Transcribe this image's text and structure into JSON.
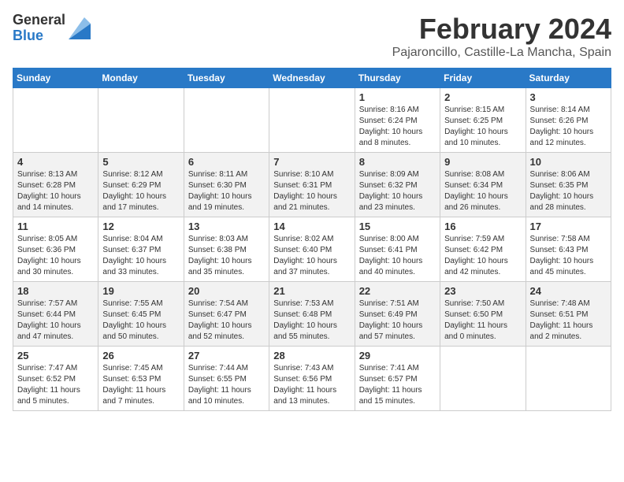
{
  "header": {
    "logo_general": "General",
    "logo_blue": "Blue",
    "month_title": "February 2024",
    "location": "Pajaroncillo, Castille-La Mancha, Spain"
  },
  "days_of_week": [
    "Sunday",
    "Monday",
    "Tuesday",
    "Wednesday",
    "Thursday",
    "Friday",
    "Saturday"
  ],
  "weeks": [
    [
      {
        "day": "",
        "info": ""
      },
      {
        "day": "",
        "info": ""
      },
      {
        "day": "",
        "info": ""
      },
      {
        "day": "",
        "info": ""
      },
      {
        "day": "1",
        "info": "Sunrise: 8:16 AM\nSunset: 6:24 PM\nDaylight: 10 hours\nand 8 minutes."
      },
      {
        "day": "2",
        "info": "Sunrise: 8:15 AM\nSunset: 6:25 PM\nDaylight: 10 hours\nand 10 minutes."
      },
      {
        "day": "3",
        "info": "Sunrise: 8:14 AM\nSunset: 6:26 PM\nDaylight: 10 hours\nand 12 minutes."
      }
    ],
    [
      {
        "day": "4",
        "info": "Sunrise: 8:13 AM\nSunset: 6:28 PM\nDaylight: 10 hours\nand 14 minutes."
      },
      {
        "day": "5",
        "info": "Sunrise: 8:12 AM\nSunset: 6:29 PM\nDaylight: 10 hours\nand 17 minutes."
      },
      {
        "day": "6",
        "info": "Sunrise: 8:11 AM\nSunset: 6:30 PM\nDaylight: 10 hours\nand 19 minutes."
      },
      {
        "day": "7",
        "info": "Sunrise: 8:10 AM\nSunset: 6:31 PM\nDaylight: 10 hours\nand 21 minutes."
      },
      {
        "day": "8",
        "info": "Sunrise: 8:09 AM\nSunset: 6:32 PM\nDaylight: 10 hours\nand 23 minutes."
      },
      {
        "day": "9",
        "info": "Sunrise: 8:08 AM\nSunset: 6:34 PM\nDaylight: 10 hours\nand 26 minutes."
      },
      {
        "day": "10",
        "info": "Sunrise: 8:06 AM\nSunset: 6:35 PM\nDaylight: 10 hours\nand 28 minutes."
      }
    ],
    [
      {
        "day": "11",
        "info": "Sunrise: 8:05 AM\nSunset: 6:36 PM\nDaylight: 10 hours\nand 30 minutes."
      },
      {
        "day": "12",
        "info": "Sunrise: 8:04 AM\nSunset: 6:37 PM\nDaylight: 10 hours\nand 33 minutes."
      },
      {
        "day": "13",
        "info": "Sunrise: 8:03 AM\nSunset: 6:38 PM\nDaylight: 10 hours\nand 35 minutes."
      },
      {
        "day": "14",
        "info": "Sunrise: 8:02 AM\nSunset: 6:40 PM\nDaylight: 10 hours\nand 37 minutes."
      },
      {
        "day": "15",
        "info": "Sunrise: 8:00 AM\nSunset: 6:41 PM\nDaylight: 10 hours\nand 40 minutes."
      },
      {
        "day": "16",
        "info": "Sunrise: 7:59 AM\nSunset: 6:42 PM\nDaylight: 10 hours\nand 42 minutes."
      },
      {
        "day": "17",
        "info": "Sunrise: 7:58 AM\nSunset: 6:43 PM\nDaylight: 10 hours\nand 45 minutes."
      }
    ],
    [
      {
        "day": "18",
        "info": "Sunrise: 7:57 AM\nSunset: 6:44 PM\nDaylight: 10 hours\nand 47 minutes."
      },
      {
        "day": "19",
        "info": "Sunrise: 7:55 AM\nSunset: 6:45 PM\nDaylight: 10 hours\nand 50 minutes."
      },
      {
        "day": "20",
        "info": "Sunrise: 7:54 AM\nSunset: 6:47 PM\nDaylight: 10 hours\nand 52 minutes."
      },
      {
        "day": "21",
        "info": "Sunrise: 7:53 AM\nSunset: 6:48 PM\nDaylight: 10 hours\nand 55 minutes."
      },
      {
        "day": "22",
        "info": "Sunrise: 7:51 AM\nSunset: 6:49 PM\nDaylight: 10 hours\nand 57 minutes."
      },
      {
        "day": "23",
        "info": "Sunrise: 7:50 AM\nSunset: 6:50 PM\nDaylight: 11 hours\nand 0 minutes."
      },
      {
        "day": "24",
        "info": "Sunrise: 7:48 AM\nSunset: 6:51 PM\nDaylight: 11 hours\nand 2 minutes."
      }
    ],
    [
      {
        "day": "25",
        "info": "Sunrise: 7:47 AM\nSunset: 6:52 PM\nDaylight: 11 hours\nand 5 minutes."
      },
      {
        "day": "26",
        "info": "Sunrise: 7:45 AM\nSunset: 6:53 PM\nDaylight: 11 hours\nand 7 minutes."
      },
      {
        "day": "27",
        "info": "Sunrise: 7:44 AM\nSunset: 6:55 PM\nDaylight: 11 hours\nand 10 minutes."
      },
      {
        "day": "28",
        "info": "Sunrise: 7:43 AM\nSunset: 6:56 PM\nDaylight: 11 hours\nand 13 minutes."
      },
      {
        "day": "29",
        "info": "Sunrise: 7:41 AM\nSunset: 6:57 PM\nDaylight: 11 hours\nand 15 minutes."
      },
      {
        "day": "",
        "info": ""
      },
      {
        "day": "",
        "info": ""
      }
    ]
  ]
}
